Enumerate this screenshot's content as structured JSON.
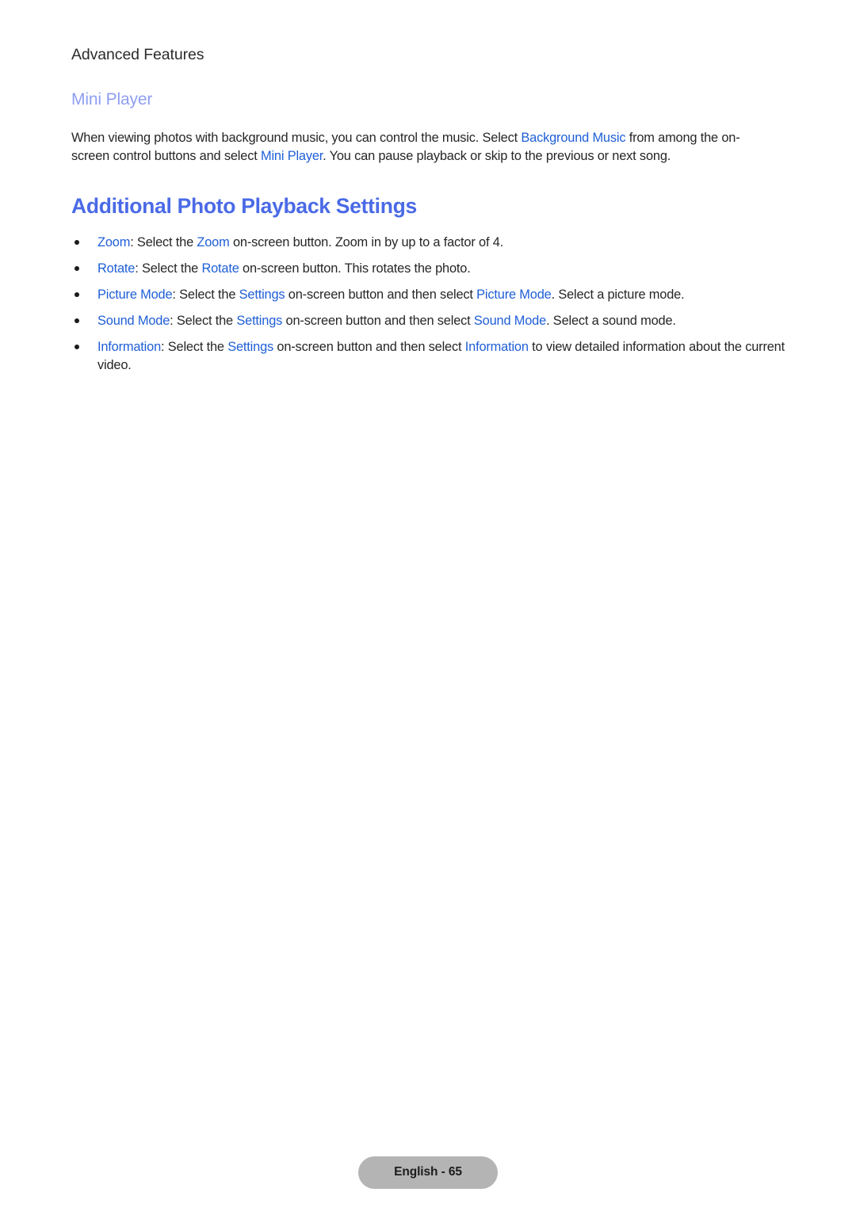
{
  "page": {
    "running_header": "Advanced Features",
    "sub_heading": "Mini Player",
    "section_heading": "Additional Photo Playback Settings",
    "footer_label": "English - 65"
  },
  "colors": {
    "heading_blue": "#4a6ae6",
    "subheading_periwinkle": "#8e9ef2",
    "link_blue": "#1f5fd6",
    "body_text": "#262626",
    "header_text": "#2b2b2b",
    "footer_pill_bg": "#b4b4b4",
    "page_background": "#ffffff"
  },
  "intro_paragraph": {
    "seg1": "When viewing photos with background music, you can control the music. Select ",
    "link1": "Background Music",
    "seg2": " from among the on-screen control buttons and select ",
    "link2": "Mini Player",
    "seg3": ". You can pause playback or skip to the previous or next song."
  },
  "bullets": [
    {
      "term": "Zoom",
      "seg1": ": Select the ",
      "link1": "Zoom",
      "seg2": " on-screen button. Zoom in by up to a factor of 4.",
      "link2": "",
      "seg3": ""
    },
    {
      "term": "Rotate",
      "seg1": ": Select the ",
      "link1": "Rotate",
      "seg2": " on-screen button. This rotates the photo.",
      "link2": "",
      "seg3": ""
    },
    {
      "term": "Picture Mode",
      "seg1": ": Select the ",
      "link1": "Settings",
      "seg2": " on-screen button and then select ",
      "link2": "Picture Mode",
      "seg3": ". Select a picture mode."
    },
    {
      "term": "Sound Mode",
      "seg1": ": Select the ",
      "link1": "Settings",
      "seg2": " on-screen button and then select ",
      "link2": "Sound Mode",
      "seg3": ". Select a sound mode."
    },
    {
      "term": "Information",
      "seg1": ": Select the ",
      "link1": "Settings",
      "seg2": " on-screen button and then select ",
      "link2": "Information",
      "seg3": " to view detailed information about the current video."
    }
  ]
}
